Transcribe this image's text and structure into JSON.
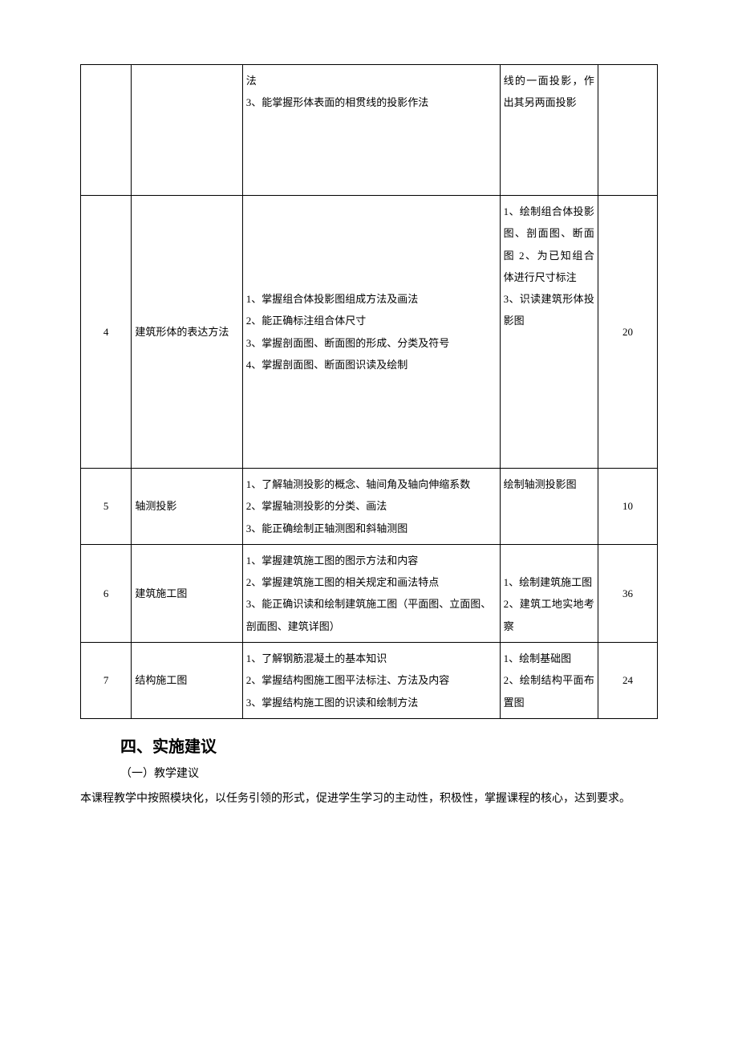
{
  "table": {
    "rows": [
      {
        "index": "",
        "topic": "",
        "goals": "法\n3、能掌握形体表面的相贯线的投影作法",
        "tasks": "线的一面投影，作出其另两面投影",
        "hours": ""
      },
      {
        "index": "4",
        "topic": "建筑形体的表达方法",
        "goals": "1、掌握组合体投影图组成方法及画法\n2、能正确标注组合体尺寸\n3、掌握剖面图、断面图的形成、分类及符号\n4、掌握剖面图、断面图识读及绘制",
        "tasks": "1、绘制组合体投影图、剖面图、断面图 2、为已知组合体进行尺寸标注\n3、识读建筑形体投影图",
        "hours": "20"
      },
      {
        "index": "5",
        "topic": "轴测投影",
        "goals": "1、了解轴测投影的概念、轴间角及轴向伸缩系数\n2、掌握轴测投影的分类、画法\n3、能正确绘制正轴测图和斜轴测图",
        "tasks": "绘制轴测投影图",
        "hours": "10"
      },
      {
        "index": "6",
        "topic": "建筑施工图",
        "goals": "1、掌握建筑施工图的图示方法和内容\n2、掌握建筑施工图的相关规定和画法特点\n3、能正确识读和绘制建筑施工图（平面图、立面图、剖面图、建筑详图）",
        "tasks": "1、绘制建筑施工图\n2、建筑工地实地考察",
        "hours": "36"
      },
      {
        "index": "7",
        "topic": "结构施工图",
        "goals": "1、了解钢筋混凝土的基本知识\n2、掌握结构图施工图平法标注、方法及内容\n3、掌握结构施工图的识读和绘制方法",
        "tasks": "1、绘制基础图\n2、绘制结构平面布置图",
        "hours": "24"
      }
    ]
  },
  "section_heading": "四、实施建议",
  "subheading": "（一）教学建议",
  "paragraph": "本课程教学中按照模块化，以任务引领的形式，促进学生学习的主动性，积极性，掌握课程的核心，达到要求。"
}
